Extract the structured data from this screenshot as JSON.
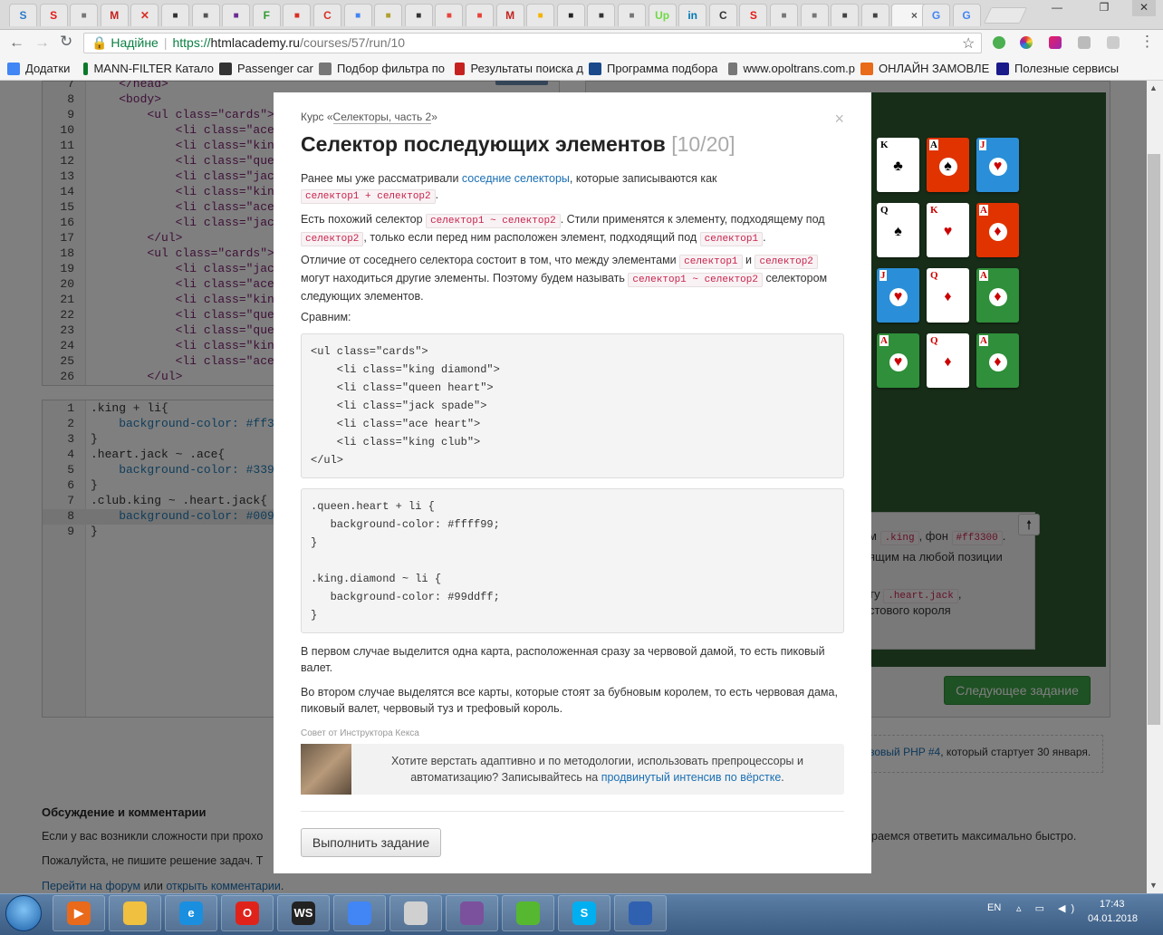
{
  "browser": {
    "tabs": [
      {
        "icon": "skype-icon",
        "label": "S",
        "color": "#2d7ac8"
      },
      {
        "icon": "s-red-icon",
        "label": "S",
        "color": "#e41b17"
      },
      {
        "icon": "doc-icon",
        "label": "",
        "color": "#777777"
      },
      {
        "icon": "gmail-icon",
        "label": "M",
        "color": "#c5221f"
      },
      {
        "icon": "tool-icon",
        "label": "✕",
        "color": "#d93025"
      },
      {
        "icon": "building-icon",
        "label": "",
        "color": "#333333"
      },
      {
        "icon": "feather-icon",
        "label": "",
        "color": "#555555"
      },
      {
        "icon": "purple-square-icon",
        "label": "",
        "color": "#6a2c91"
      },
      {
        "icon": "f-green-icon",
        "label": "F",
        "color": "#2e9b2e"
      },
      {
        "icon": "thermometer-icon",
        "label": "",
        "color": "#d93025"
      },
      {
        "icon": "c-red-icon",
        "label": "C",
        "color": "#d93025"
      },
      {
        "icon": "translate-icon",
        "label": "",
        "color": "#4285f4"
      },
      {
        "icon": "bulb-icon",
        "label": "",
        "color": "#b0a030"
      },
      {
        "icon": "htmlacademy-icon",
        "label": "",
        "color": "#333333"
      },
      {
        "icon": "runner-icon",
        "label": "",
        "color": "#e8453c"
      },
      {
        "icon": "runner-icon",
        "label": "",
        "color": "#e8453c"
      },
      {
        "icon": "gmail-icon",
        "label": "M",
        "color": "#c5221f"
      },
      {
        "icon": "smile-icon",
        "label": "",
        "color": "#f5b400"
      },
      {
        "icon": "terminal-icon",
        "label": "",
        "color": "#222222"
      },
      {
        "icon": "htmlacademy-icon",
        "label": "",
        "color": "#333333"
      },
      {
        "icon": "doc-icon",
        "label": "",
        "color": "#777777"
      },
      {
        "icon": "upwork-icon",
        "label": "Up",
        "color": "#6fda44"
      },
      {
        "icon": "linkedin-icon",
        "label": "in",
        "color": "#0077b5"
      },
      {
        "icon": "doc-c-icon",
        "label": "C",
        "color": "#333333"
      },
      {
        "icon": "s-red-icon",
        "label": "S",
        "color": "#e41b17"
      },
      {
        "icon": "doc-icon",
        "label": "",
        "color": "#777777"
      },
      {
        "icon": "doc-icon",
        "label": "",
        "color": "#777777"
      },
      {
        "icon": "shield-icon",
        "label": "",
        "color": "#444444"
      },
      {
        "icon": "shield-icon",
        "label": "",
        "color": "#444444"
      },
      {
        "icon": "close-icon",
        "label": "×",
        "color": "#555555",
        "active": true
      },
      {
        "icon": "google-icon",
        "label": "G",
        "color": "#4285f4"
      },
      {
        "icon": "google-icon",
        "label": "G",
        "color": "#4285f4"
      }
    ],
    "window_controls": {
      "minimize": "—",
      "restore": "❐",
      "close": "✕"
    },
    "address": {
      "secure_label": "Надійне",
      "scheme": "https://",
      "host": "htmlacademy.ru",
      "path": "/courses/57/run/10"
    },
    "bookmarks": [
      {
        "icon": "apps-icon",
        "label": "Додатки",
        "color": "#4285f4"
      },
      {
        "icon": "mann-icon",
        "label": "MANN-FILTER Катало",
        "color": "#0a7a2a"
      },
      {
        "icon": "wix-icon",
        "label": "Passenger car",
        "color": "#333333"
      },
      {
        "icon": "doc-icon",
        "label": "Подбор фильтра по",
        "color": "#777777"
      },
      {
        "icon": "m-red-icon",
        "label": "Результаты поиска д",
        "color": "#c5221f"
      },
      {
        "icon": "omega-icon",
        "label": "Программа подбора",
        "color": "#1a4a8a"
      },
      {
        "icon": "doc-icon",
        "label": "www.opoltrans.com.p",
        "color": "#777777"
      },
      {
        "icon": "g-orange-icon",
        "label": "ОНЛАЙН ЗАМОВЛЕ",
        "color": "#e86a1a"
      },
      {
        "icon": "a-icon",
        "label": "Полезные сервисы",
        "color": "#1a1a8a"
      }
    ]
  },
  "editor_html": {
    "lines": [
      {
        "n": "7",
        "text": "    </head>"
      },
      {
        "n": "8",
        "text": "    <body>"
      },
      {
        "n": "9",
        "text": "        <ul class=\"cards\">"
      },
      {
        "n": "10",
        "text": "            <li class=\"ace"
      },
      {
        "n": "11",
        "text": "            <li class=\"king"
      },
      {
        "n": "12",
        "text": "            <li class=\"quee"
      },
      {
        "n": "13",
        "text": "            <li class=\"jack"
      },
      {
        "n": "14",
        "text": "            <li class=\"king"
      },
      {
        "n": "15",
        "text": "            <li class=\"ace"
      },
      {
        "n": "16",
        "text": "            <li class=\"jack"
      },
      {
        "n": "17",
        "text": "        </ul>"
      },
      {
        "n": "18",
        "text": "        <ul class=\"cards\">"
      },
      {
        "n": "19",
        "text": "            <li class=\"jack"
      },
      {
        "n": "20",
        "text": "            <li class=\"ace"
      },
      {
        "n": "21",
        "text": "            <li class=\"king"
      },
      {
        "n": "22",
        "text": "            <li class=\"quee"
      },
      {
        "n": "23",
        "text": "            <li class=\"quee"
      },
      {
        "n": "24",
        "text": "            <li class=\"king"
      },
      {
        "n": "25",
        "text": "            <li class=\"ace"
      },
      {
        "n": "26",
        "text": "        </ul>"
      }
    ]
  },
  "editor_css": {
    "lines": [
      {
        "n": "1",
        "text": ".king + li{"
      },
      {
        "n": "2",
        "text": "    background-color: #ff33"
      },
      {
        "n": "3",
        "text": "}"
      },
      {
        "n": "4",
        "text": ".heart.jack ~ .ace{"
      },
      {
        "n": "5",
        "text": "    background-color: #3399"
      },
      {
        "n": "6",
        "text": "}"
      },
      {
        "n": "7",
        "text": ".club.king ~ .heart.jack{"
      },
      {
        "n": "8",
        "text": "    background-color: #0099"
      },
      {
        "n": "9",
        "text": "}"
      }
    ]
  },
  "board": {
    "cards": [
      {
        "rank": "K",
        "suit": "♣",
        "bg": "#ffffff",
        "red": false
      },
      {
        "rank": "A",
        "suit": "♠",
        "bg": "#e03300",
        "red": false
      },
      {
        "rank": "J",
        "suit": "♥",
        "bg": "#2a8fd8",
        "red": true
      },
      {
        "rank": "Q",
        "suit": "♠",
        "bg": "#ffffff",
        "red": false
      },
      {
        "rank": "K",
        "suit": "♥",
        "bg": "#ffffff",
        "red": true
      },
      {
        "rank": "A",
        "suit": "♦",
        "bg": "#e03300",
        "red": true
      },
      {
        "rank": "J",
        "suit": "♥",
        "bg": "#2a8fd8",
        "red": true
      },
      {
        "rank": "Q",
        "suit": "♦",
        "bg": "#ffffff",
        "red": true
      },
      {
        "rank": "A",
        "suit": "♦",
        "bg": "#2f8f3a",
        "red": true
      },
      {
        "rank": "A",
        "suit": "♥",
        "bg": "#2f8f3a",
        "red": true
      },
      {
        "rank": "Q",
        "suit": "♦",
        "bg": "#ffffff",
        "red": true
      },
      {
        "rank": "A",
        "suit": "♦",
        "bg": "#2f8f3a",
        "red": true
      }
    ]
  },
  "task_panel": {
    "line1_pre": "м",
    "line1_code1": ".king",
    "line1_mid": ", фон",
    "line1_code2": "#ff3300",
    "line1_post": ".",
    "line2": "ящим на любой позиции",
    "line3_pre": "ту",
    "line3_code": ".heart.jack",
    "line3_post": ",",
    "line4": "стового короля"
  },
  "next_button": "Следующее задание",
  "promo_text_link": "зовый PHP #4",
  "promo_text_rest": ", который стартует 30 января.",
  "discussion": {
    "title": "Обсуждение и комментарии",
    "p1_left": "Если у вас возникли сложности при прохо",
    "p1_right": "раемся ответить максимально быстро.",
    "p2_left": "Пожалуйста, не пишите решение задач. Т",
    "link1": "Перейти на форум",
    "or": " или ",
    "link2": "открыть комментарии",
    "end": "."
  },
  "modal": {
    "course_prefix": "Курс «",
    "course_link": "Селекторы, часть 2",
    "course_suffix": "»",
    "close": "×",
    "title": "Селектор последующих элементов",
    "counter": "[10/20]",
    "p1_a": "Ранее мы уже рассматривали ",
    "p1_link": "соседние селекторы",
    "p1_b": ", которые записываются как",
    "p1_code": "селектор1 + селектор2",
    "p1_end": ".",
    "p2_a": "Есть похожий селектор ",
    "p2_code1": "селектор1 ~ селектор2",
    "p2_b": ". Стили применятся к элементу, подходящему под",
    "p2_code2": "селектор2",
    "p2_c": ", только если перед ним расположен элемент, подходящий под ",
    "p2_code3": "селектор1",
    "p2_end": ".",
    "p3_a": "Отличие от соседнего селектора состоит в том, что между элементами ",
    "p3_code1": "селектор1",
    "p3_b": " и ",
    "p3_code2": "селектор2",
    "p3_c": "могут находиться другие элементы. Поэтому будем называть ",
    "p3_code3": "селектор1 ~ селектор2",
    "p3_d": " селектором",
    "p3_e": "следующих элементов.",
    "compare": "Сравним:",
    "code_html": "<ul class=\"cards\">\n    <li class=\"king diamond\">\n    <li class=\"queen heart\">\n    <li class=\"jack spade\">\n    <li class=\"ace heart\">\n    <li class=\"king club\">\n</ul>",
    "code_css": ".queen.heart + li {\n   background-color: #ffff99;\n}\n\n.king.diamond ~ li {\n   background-color: #99ddff;\n}",
    "p4": "В первом случае выделится одна карта, расположенная сразу за червовой дамой, то есть пиковый валет.",
    "p5": "Во втором случае выделятся все карты, которые стоят за бубновым королем, то есть червовая дама, пиковый валет, червовый туз и трефовый король.",
    "tip_label": "Совет от Инструктора Кекса",
    "tip_text": "Хотите верстать адаптивно и по методологии, использовать препроцессоры и автоматизацию? Записывайтесь на ",
    "tip_link": "продвинутый интенсив по вёрстке",
    "tip_end": ".",
    "run_button": "Выполнить задание"
  },
  "taskbar": {
    "apps": [
      {
        "icon": "media-player-icon",
        "label": "▶",
        "color": "#e86a1a"
      },
      {
        "icon": "explorer-icon",
        "label": "",
        "color": "#f0c040"
      },
      {
        "icon": "ie-icon",
        "label": "e",
        "color": "#1a8fe0"
      },
      {
        "icon": "opera-icon",
        "label": "O",
        "color": "#e0231a"
      },
      {
        "icon": "webstorm-icon",
        "label": "WS",
        "color": "#222222"
      },
      {
        "icon": "chrome-icon",
        "label": "",
        "color": "#4285f4"
      },
      {
        "icon": "calculator-icon",
        "label": "",
        "color": "#d0d0d0"
      },
      {
        "icon": "viber-icon",
        "label": "",
        "color": "#7b519d"
      },
      {
        "icon": "icq-icon",
        "label": "",
        "color": "#55b830"
      },
      {
        "icon": "skype-icon",
        "label": "S",
        "color": "#00aff0"
      },
      {
        "icon": "remote-desktop-icon",
        "label": "",
        "color": "#3060b0"
      }
    ],
    "lang": "EN",
    "time": "17:43",
    "date": "04.01.2018"
  }
}
